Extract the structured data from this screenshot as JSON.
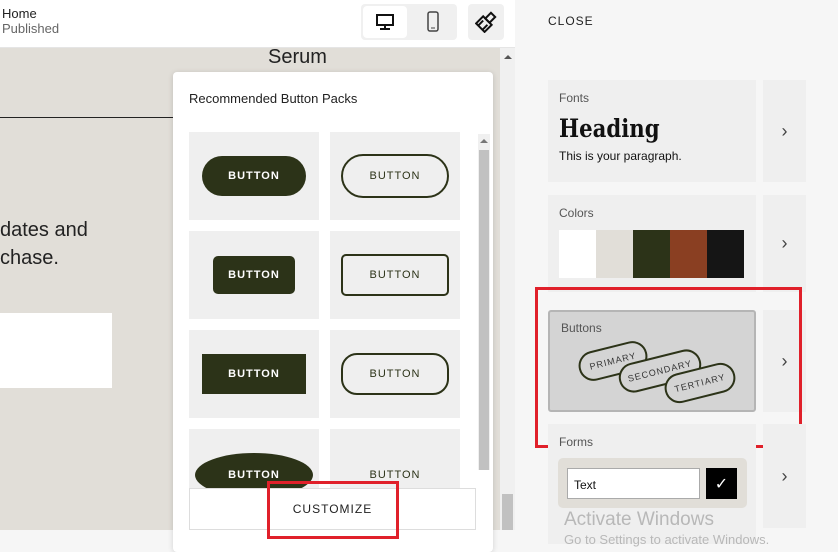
{
  "header": {
    "page": "Home",
    "status": "Published",
    "desktop_icon": "desktop-icon",
    "mobile_icon": "mobile-icon",
    "style_icon": "paintbrush-icon"
  },
  "canvas": {
    "heading": "Serum",
    "body_lines": [
      "dates and",
      "chase."
    ]
  },
  "popup": {
    "title": "Recommended Button Packs",
    "button_label": "BUTTON",
    "customize_label": "CUSTOMIZE",
    "accent": "#2c3318"
  },
  "panel": {
    "close_label": "CLOSE",
    "fonts": {
      "label": "Fonts",
      "heading": "Heading",
      "paragraph": "This is your paragraph."
    },
    "colors": {
      "label": "Colors",
      "swatches": [
        "#ffffff",
        "#e1ded8",
        "#2c3318",
        "#8a3f22",
        "#151515"
      ]
    },
    "buttons": {
      "label": "Buttons",
      "primary": "PRIMARY",
      "secondary": "SECONDARY",
      "tertiary": "TERTIARY"
    },
    "forms": {
      "label": "Forms",
      "input_value": "Text"
    },
    "arrow": "›"
  },
  "watermark": {
    "line1": "Activate Windows",
    "line2": "Go to Settings to activate Windows."
  }
}
